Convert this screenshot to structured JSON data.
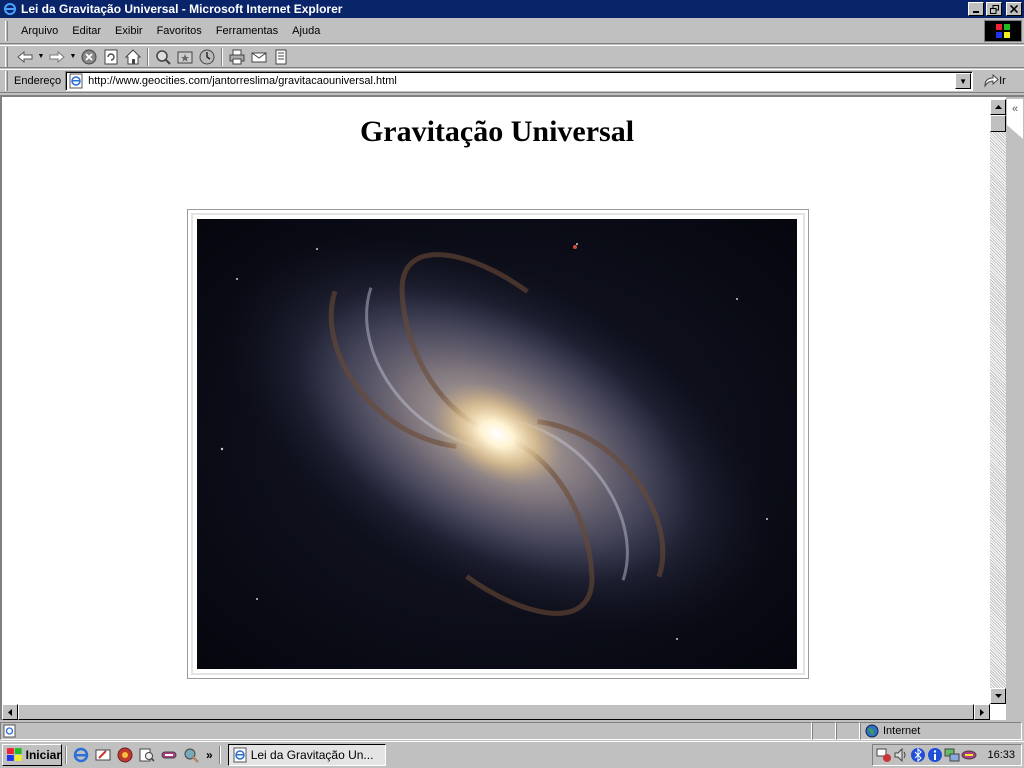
{
  "window": {
    "title": "Lei da Gravitação Universal - Microsoft Internet Explorer"
  },
  "menu": {
    "items": [
      {
        "label": "Arquivo"
      },
      {
        "label": "Editar"
      },
      {
        "label": "Exibir"
      },
      {
        "label": "Favoritos"
      },
      {
        "label": "Ferramentas"
      },
      {
        "label": "Ajuda"
      }
    ]
  },
  "toolbar": {
    "icons": [
      "back-icon",
      "forward-icon",
      "stop-icon",
      "refresh-icon",
      "home-icon",
      "search-icon",
      "favorites-icon",
      "history-icon",
      "print-icon",
      "mail-icon",
      "edit-icon"
    ]
  },
  "address": {
    "label": "Endereço",
    "url": "http://www.geocities.com/jantorreslima/gravitacaouniversal.html",
    "go_label": "Ir"
  },
  "page": {
    "heading": "Gravitação Universal",
    "image_subject": "spiral-galaxy"
  },
  "sidepanel": {
    "toggle": "«"
  },
  "status": {
    "zone": "Internet"
  },
  "taskbar": {
    "start_label": "Iniciar",
    "more": "»",
    "task_label": "Lei da Gravitação Un...",
    "clock": "16:33"
  },
  "colors": {
    "titlebar": "#0a246a",
    "chrome": "#c0c0c0"
  }
}
